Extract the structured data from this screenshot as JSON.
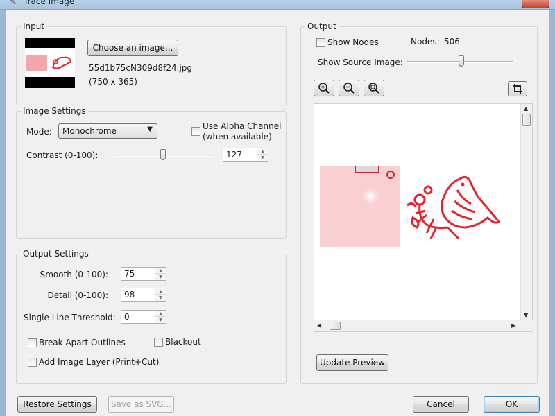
{
  "window": {
    "title": "Trace Image"
  },
  "input": {
    "group_label": "Input",
    "choose_button": "Choose an image...",
    "filename": "55d1b75cN309d8f24.jpg",
    "dimensions": "(750 x 365)"
  },
  "image_settings": {
    "group_label": "Image Settings",
    "mode_label": "Mode:",
    "mode_value": "Monochrome",
    "alpha_label_line1": "Use Alpha Channel",
    "alpha_label_line2": "(when available)",
    "alpha_checked": false,
    "contrast_label": "Contrast (0-100):",
    "contrast_value": "127",
    "contrast_slider_fraction": 0.5
  },
  "output_settings": {
    "group_label": "Output Settings",
    "smooth_label": "Smooth (0-100):",
    "smooth_value": "75",
    "detail_label": "Detail (0-100):",
    "detail_value": "98",
    "threshold_label": "Single Line Threshold:",
    "threshold_value": "0",
    "break_apart_label": "Break Apart Outlines",
    "break_apart_checked": false,
    "blackout_label": "Blackout",
    "blackout_checked": false,
    "add_image_layer_label": "Add Image Layer (Print+Cut)",
    "add_image_layer_checked": false
  },
  "output": {
    "group_label": "Output",
    "show_nodes_label": "Show Nodes",
    "show_nodes_checked": false,
    "nodes_label": "Nodes:",
    "nodes_value": "506",
    "show_source_label": "Show Source Image:",
    "show_source_slider_fraction": 0.5,
    "icons": [
      "zoom-in-icon",
      "zoom-out-icon",
      "zoom-fit-icon",
      "crop-icon"
    ],
    "update_preview_button": "Update Preview"
  },
  "footer": {
    "restore_button": "Restore Settings",
    "save_svg_button": "Save as SVG...",
    "cancel_button": "Cancel",
    "ok_button": "OK"
  },
  "colors": {
    "trace_red": "#e8212b",
    "trace_pink": "#f7c2c5"
  }
}
